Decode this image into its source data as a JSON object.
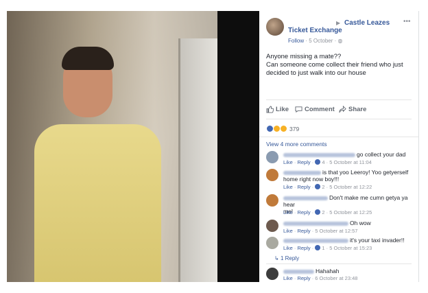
{
  "post": {
    "page_name": "Ticket Exchange",
    "destination": "Castle Leazes",
    "follow": "Follow",
    "date": "5 October",
    "text_line1": "Anyone missing a mate??",
    "text_line2": "Can someone come collect their friend who just decided to just walk into our house"
  },
  "actions": {
    "like": "Like",
    "comment": "Comment",
    "share": "Share"
  },
  "reactions": {
    "count": "379"
  },
  "comments": {
    "view_more": "View 4 more comments",
    "items": [
      {
        "text": "go collect your dad",
        "like": "Like",
        "reply": "Reply",
        "likes": "4",
        "time": "5 October at 11:04"
      },
      {
        "text_l1": "is that yoo Leeroy! Yoo getyerself",
        "text_l2": "home right now boy!!!",
        "like": "Like",
        "reply": "Reply",
        "likes": "2",
        "time": "5 October at 12:22"
      },
      {
        "text_l1": "Don't make me cumn getya ya hear",
        "text_l2": "me!",
        "like": "Like",
        "reply": "Reply",
        "likes": "2",
        "time": "5 October at 12:25"
      },
      {
        "text": "Oh wow",
        "like": "Like",
        "reply": "Reply",
        "time": "5 October at 12:57"
      },
      {
        "text": "it's your taxi invader!!",
        "like": "Like",
        "reply": "Reply",
        "likes": "1",
        "time": "5 October at 15:23"
      },
      {
        "text": "Hahahah",
        "like": "Like",
        "reply": "Reply",
        "time": "6 October at 23:48"
      }
    ],
    "reply_count": "1 Reply"
  }
}
